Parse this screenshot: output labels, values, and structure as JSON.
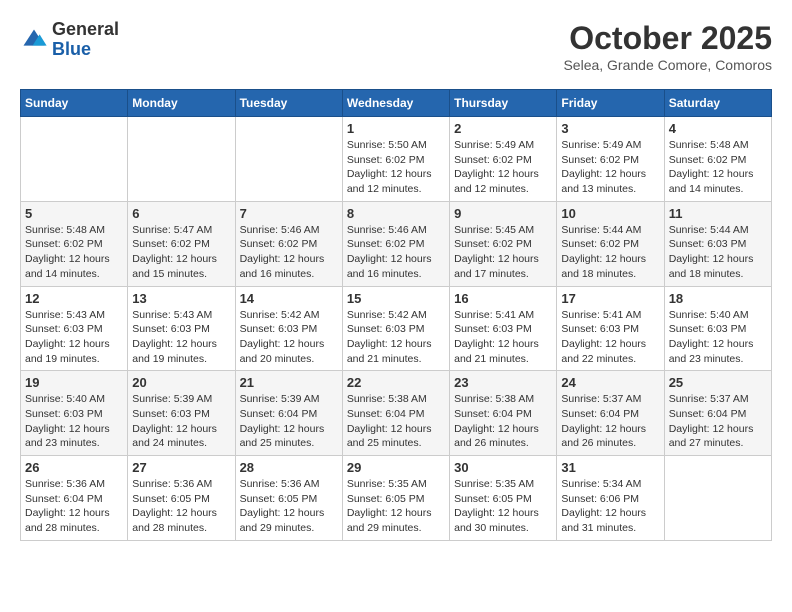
{
  "header": {
    "logo": {
      "general": "General",
      "blue": "Blue"
    },
    "title": "October 2025",
    "location": "Selea, Grande Comore, Comoros"
  },
  "calendar": {
    "days_of_week": [
      "Sunday",
      "Monday",
      "Tuesday",
      "Wednesday",
      "Thursday",
      "Friday",
      "Saturday"
    ],
    "weeks": [
      [
        {
          "day": "",
          "info": ""
        },
        {
          "day": "",
          "info": ""
        },
        {
          "day": "",
          "info": ""
        },
        {
          "day": "1",
          "info": "Sunrise: 5:50 AM\nSunset: 6:02 PM\nDaylight: 12 hours and 12 minutes."
        },
        {
          "day": "2",
          "info": "Sunrise: 5:49 AM\nSunset: 6:02 PM\nDaylight: 12 hours and 12 minutes."
        },
        {
          "day": "3",
          "info": "Sunrise: 5:49 AM\nSunset: 6:02 PM\nDaylight: 12 hours and 13 minutes."
        },
        {
          "day": "4",
          "info": "Sunrise: 5:48 AM\nSunset: 6:02 PM\nDaylight: 12 hours and 14 minutes."
        }
      ],
      [
        {
          "day": "5",
          "info": "Sunrise: 5:48 AM\nSunset: 6:02 PM\nDaylight: 12 hours and 14 minutes."
        },
        {
          "day": "6",
          "info": "Sunrise: 5:47 AM\nSunset: 6:02 PM\nDaylight: 12 hours and 15 minutes."
        },
        {
          "day": "7",
          "info": "Sunrise: 5:46 AM\nSunset: 6:02 PM\nDaylight: 12 hours and 16 minutes."
        },
        {
          "day": "8",
          "info": "Sunrise: 5:46 AM\nSunset: 6:02 PM\nDaylight: 12 hours and 16 minutes."
        },
        {
          "day": "9",
          "info": "Sunrise: 5:45 AM\nSunset: 6:02 PM\nDaylight: 12 hours and 17 minutes."
        },
        {
          "day": "10",
          "info": "Sunrise: 5:44 AM\nSunset: 6:02 PM\nDaylight: 12 hours and 18 minutes."
        },
        {
          "day": "11",
          "info": "Sunrise: 5:44 AM\nSunset: 6:03 PM\nDaylight: 12 hours and 18 minutes."
        }
      ],
      [
        {
          "day": "12",
          "info": "Sunrise: 5:43 AM\nSunset: 6:03 PM\nDaylight: 12 hours and 19 minutes."
        },
        {
          "day": "13",
          "info": "Sunrise: 5:43 AM\nSunset: 6:03 PM\nDaylight: 12 hours and 19 minutes."
        },
        {
          "day": "14",
          "info": "Sunrise: 5:42 AM\nSunset: 6:03 PM\nDaylight: 12 hours and 20 minutes."
        },
        {
          "day": "15",
          "info": "Sunrise: 5:42 AM\nSunset: 6:03 PM\nDaylight: 12 hours and 21 minutes."
        },
        {
          "day": "16",
          "info": "Sunrise: 5:41 AM\nSunset: 6:03 PM\nDaylight: 12 hours and 21 minutes."
        },
        {
          "day": "17",
          "info": "Sunrise: 5:41 AM\nSunset: 6:03 PM\nDaylight: 12 hours and 22 minutes."
        },
        {
          "day": "18",
          "info": "Sunrise: 5:40 AM\nSunset: 6:03 PM\nDaylight: 12 hours and 23 minutes."
        }
      ],
      [
        {
          "day": "19",
          "info": "Sunrise: 5:40 AM\nSunset: 6:03 PM\nDaylight: 12 hours and 23 minutes."
        },
        {
          "day": "20",
          "info": "Sunrise: 5:39 AM\nSunset: 6:03 PM\nDaylight: 12 hours and 24 minutes."
        },
        {
          "day": "21",
          "info": "Sunrise: 5:39 AM\nSunset: 6:04 PM\nDaylight: 12 hours and 25 minutes."
        },
        {
          "day": "22",
          "info": "Sunrise: 5:38 AM\nSunset: 6:04 PM\nDaylight: 12 hours and 25 minutes."
        },
        {
          "day": "23",
          "info": "Sunrise: 5:38 AM\nSunset: 6:04 PM\nDaylight: 12 hours and 26 minutes."
        },
        {
          "day": "24",
          "info": "Sunrise: 5:37 AM\nSunset: 6:04 PM\nDaylight: 12 hours and 26 minutes."
        },
        {
          "day": "25",
          "info": "Sunrise: 5:37 AM\nSunset: 6:04 PM\nDaylight: 12 hours and 27 minutes."
        }
      ],
      [
        {
          "day": "26",
          "info": "Sunrise: 5:36 AM\nSunset: 6:04 PM\nDaylight: 12 hours and 28 minutes."
        },
        {
          "day": "27",
          "info": "Sunrise: 5:36 AM\nSunset: 6:05 PM\nDaylight: 12 hours and 28 minutes."
        },
        {
          "day": "28",
          "info": "Sunrise: 5:36 AM\nSunset: 6:05 PM\nDaylight: 12 hours and 29 minutes."
        },
        {
          "day": "29",
          "info": "Sunrise: 5:35 AM\nSunset: 6:05 PM\nDaylight: 12 hours and 29 minutes."
        },
        {
          "day": "30",
          "info": "Sunrise: 5:35 AM\nSunset: 6:05 PM\nDaylight: 12 hours and 30 minutes."
        },
        {
          "day": "31",
          "info": "Sunrise: 5:34 AM\nSunset: 6:06 PM\nDaylight: 12 hours and 31 minutes."
        },
        {
          "day": "",
          "info": ""
        }
      ]
    ]
  }
}
